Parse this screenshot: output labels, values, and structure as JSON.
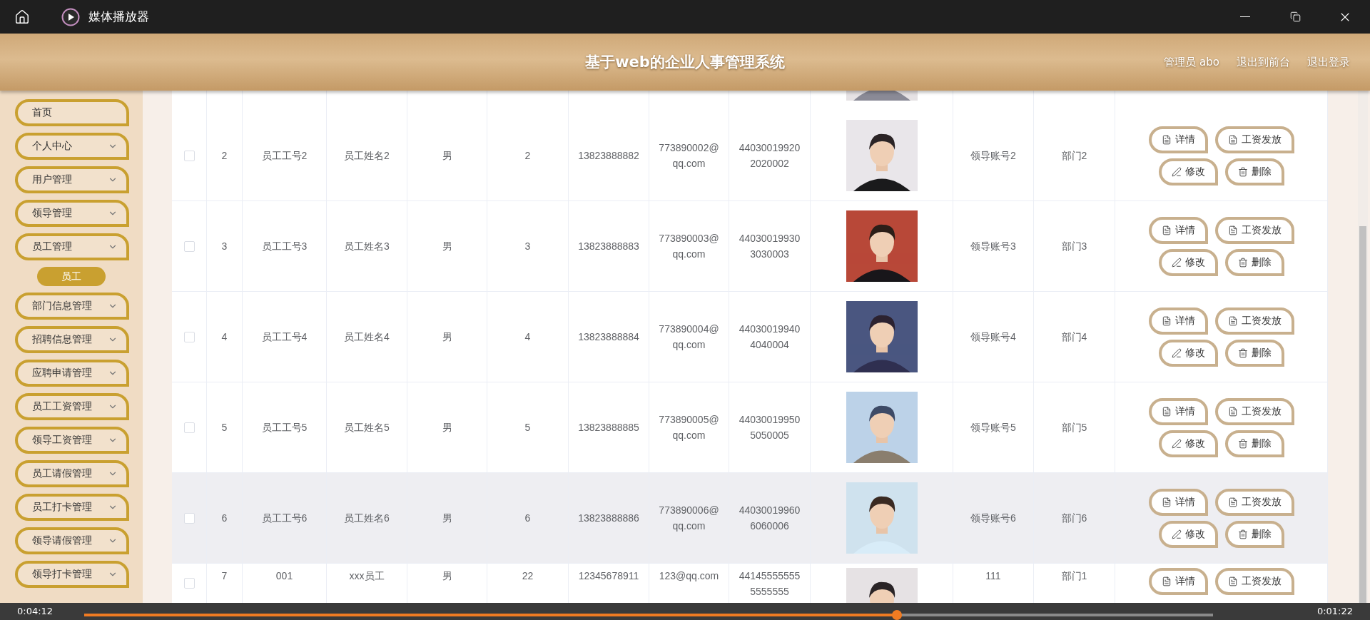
{
  "window": {
    "title": "媒体播放器"
  },
  "header": {
    "title": "基于web的企业人事管理系统",
    "links": [
      "管理员 abo",
      "退出到前台",
      "退出登录"
    ]
  },
  "sidebar": {
    "items": [
      {
        "label": "首页",
        "expandable": false
      },
      {
        "label": "个人中心",
        "expandable": true,
        "expanded": false
      },
      {
        "label": "用户管理",
        "expandable": true,
        "expanded": false
      },
      {
        "label": "领导管理",
        "expandable": true,
        "expanded": false
      },
      {
        "label": "员工管理",
        "expandable": true,
        "expanded": true,
        "children": [
          {
            "label": "员工",
            "selected": true
          }
        ]
      },
      {
        "label": "部门信息管理",
        "expandable": true,
        "expanded": false
      },
      {
        "label": "招聘信息管理",
        "expandable": true,
        "expanded": false
      },
      {
        "label": "应聘申请管理",
        "expandable": true,
        "expanded": false
      },
      {
        "label": "员工工资管理",
        "expandable": true,
        "expanded": false
      },
      {
        "label": "领导工资管理",
        "expandable": true,
        "expanded": false
      },
      {
        "label": "员工请假管理",
        "expandable": true,
        "expanded": false
      },
      {
        "label": "员工打卡管理",
        "expandable": true,
        "expanded": false
      },
      {
        "label": "领导请假管理",
        "expandable": true,
        "expanded": false
      },
      {
        "label": "领导打卡管理",
        "expandable": true,
        "expanded": false
      }
    ]
  },
  "table": {
    "rows": [
      {
        "checked": false,
        "highlighted": false,
        "cells": [
          {
            "kind": "text",
            "text": "2"
          },
          {
            "kind": "text",
            "text": "员工工号2"
          },
          {
            "kind": "text",
            "text": "员工姓名2"
          },
          {
            "kind": "text",
            "text": "男"
          },
          {
            "kind": "text",
            "text": "2"
          },
          {
            "kind": "text",
            "text": "13823888882"
          },
          {
            "kind": "text",
            "text": "773890002@qq.com"
          },
          {
            "kind": "text",
            "text": "440300199202020002"
          },
          {
            "kind": "picture"
          },
          {
            "kind": "text",
            "text": "领导账号2"
          },
          {
            "kind": "text",
            "text": "部门2"
          }
        ],
        "actions": [
          {
            "kind": "document",
            "label": "详情"
          },
          {
            "kind": "document",
            "label": "工资发放"
          },
          {
            "kind": "pencil",
            "label": "修改"
          },
          {
            "kind": "trash",
            "label": "删除"
          }
        ]
      },
      {
        "checked": false,
        "highlighted": false,
        "cells": [
          {
            "kind": "text",
            "text": "3"
          },
          {
            "kind": "text",
            "text": "员工工号3"
          },
          {
            "kind": "text",
            "text": "员工姓名3"
          },
          {
            "kind": "text",
            "text": "男"
          },
          {
            "kind": "text",
            "text": "3"
          },
          {
            "kind": "text",
            "text": "13823888883"
          },
          {
            "kind": "text",
            "text": "773890003@qq.com"
          },
          {
            "kind": "text",
            "text": "440300199303030003"
          },
          {
            "kind": "picture"
          },
          {
            "kind": "text",
            "text": "领导账号3"
          },
          {
            "kind": "text",
            "text": "部门3"
          }
        ],
        "actions": [
          {
            "kind": "document",
            "label": "详情"
          },
          {
            "kind": "document",
            "label": "工资发放"
          },
          {
            "kind": "pencil",
            "label": "修改"
          },
          {
            "kind": "trash",
            "label": "删除"
          }
        ]
      },
      {
        "checked": false,
        "highlighted": false,
        "cells": [
          {
            "kind": "text",
            "text": "4"
          },
          {
            "kind": "text",
            "text": "员工工号4"
          },
          {
            "kind": "text",
            "text": "员工姓名4"
          },
          {
            "kind": "text",
            "text": "男"
          },
          {
            "kind": "text",
            "text": "4"
          },
          {
            "kind": "text",
            "text": "13823888884"
          },
          {
            "kind": "text",
            "text": "773890004@qq.com"
          },
          {
            "kind": "text",
            "text": "440300199404040004"
          },
          {
            "kind": "picture"
          },
          {
            "kind": "text",
            "text": "领导账号4"
          },
          {
            "kind": "text",
            "text": "部门4"
          }
        ],
        "actions": [
          {
            "kind": "document",
            "label": "详情"
          },
          {
            "kind": "document",
            "label": "工资发放"
          },
          {
            "kind": "pencil",
            "label": "修改"
          },
          {
            "kind": "trash",
            "label": "删除"
          }
        ]
      },
      {
        "checked": false,
        "highlighted": false,
        "cells": [
          {
            "kind": "text",
            "text": "5"
          },
          {
            "kind": "text",
            "text": "员工工号5"
          },
          {
            "kind": "text",
            "text": "员工姓名5"
          },
          {
            "kind": "text",
            "text": "男"
          },
          {
            "kind": "text",
            "text": "5"
          },
          {
            "kind": "text",
            "text": "13823888885"
          },
          {
            "kind": "text",
            "text": "773890005@qq.com"
          },
          {
            "kind": "text",
            "text": "440300199505050005"
          },
          {
            "kind": "picture"
          },
          {
            "kind": "text",
            "text": "领导账号5"
          },
          {
            "kind": "text",
            "text": "部门5"
          }
        ],
        "actions": [
          {
            "kind": "document",
            "label": "详情"
          },
          {
            "kind": "document",
            "label": "工资发放"
          },
          {
            "kind": "pencil",
            "label": "修改"
          },
          {
            "kind": "trash",
            "label": "删除"
          }
        ]
      },
      {
        "checked": false,
        "highlighted": true,
        "cells": [
          {
            "kind": "text",
            "text": "6"
          },
          {
            "kind": "text",
            "text": "员工工号6"
          },
          {
            "kind": "text",
            "text": "员工姓名6"
          },
          {
            "kind": "text",
            "text": "男"
          },
          {
            "kind": "text",
            "text": "6"
          },
          {
            "kind": "text",
            "text": "13823888886"
          },
          {
            "kind": "text",
            "text": "773890006@qq.com"
          },
          {
            "kind": "text",
            "text": "440300199606060006"
          },
          {
            "kind": "picture"
          },
          {
            "kind": "text",
            "text": "领导账号6"
          },
          {
            "kind": "text",
            "text": "部门6"
          }
        ],
        "actions": [
          {
            "kind": "document",
            "label": "详情"
          },
          {
            "kind": "document",
            "label": "工资发放"
          },
          {
            "kind": "pencil",
            "label": "修改"
          },
          {
            "kind": "trash",
            "label": "删除"
          }
        ]
      },
      {
        "checked": false,
        "highlighted": false,
        "cells": [
          {
            "kind": "text",
            "text": "7"
          },
          {
            "kind": "text",
            "text": "001"
          },
          {
            "kind": "text",
            "text": "xxx员工"
          },
          {
            "kind": "text",
            "text": "男"
          },
          {
            "kind": "text",
            "text": "22"
          },
          {
            "kind": "text",
            "text": "12345678911"
          },
          {
            "kind": "text",
            "text": "123@qq.com"
          },
          {
            "kind": "text",
            "text": "441455555555555555"
          },
          {
            "kind": "picture"
          },
          {
            "kind": "text",
            "text": "111"
          },
          {
            "kind": "text",
            "text": "部门1"
          }
        ],
        "actions": [
          {
            "kind": "document",
            "label": "详情"
          },
          {
            "kind": "document",
            "label": "工资发放"
          }
        ]
      }
    ]
  },
  "player": {
    "elapsed": "0:04:12",
    "remaining": "0:01:22",
    "level": 0.72
  }
}
